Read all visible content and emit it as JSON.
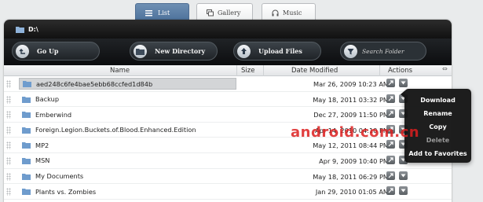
{
  "tabs": [
    {
      "label": "List",
      "icon": "list-icon",
      "active": true
    },
    {
      "label": "Gallery",
      "icon": "gallery-icon",
      "active": false
    },
    {
      "label": "Music",
      "icon": "headphones-icon",
      "active": false
    }
  ],
  "path": {
    "label": "D:\\",
    "icon": "folder-icon"
  },
  "toolbar": {
    "go_up": "Go Up",
    "new_directory": "New Directory",
    "upload_files": "Upload Files",
    "search_placeholder": "Search Folder"
  },
  "columns": {
    "name": "Name",
    "size": "Size",
    "date": "Date Modified",
    "actions": "Actions"
  },
  "rows": [
    {
      "name": "aed248c6fe4bae5ebb68ccfed1d84b",
      "size": "",
      "date": "Mar 26, 2009 10:23 AM",
      "selected": true
    },
    {
      "name": "Backup",
      "size": "",
      "date": "May 18, 2011 03:32 PM"
    },
    {
      "name": "Emberwind",
      "size": "",
      "date": "Dec 27, 2009 11:50 PM"
    },
    {
      "name": "Foreign.Legion.Buckets.of.Blood.Enhanced.Edition",
      "size": "",
      "date": "Apr 14, 2010 04:10 PM"
    },
    {
      "name": "MP2",
      "size": "",
      "date": "May 12, 2011 08:44 PM"
    },
    {
      "name": "MSN",
      "size": "",
      "date": "Apr 9, 2009 10:40 PM"
    },
    {
      "name": "My Documents",
      "size": "",
      "date": "May 18, 2011 06:29 PM"
    },
    {
      "name": "Plants vs. Zombies",
      "size": "",
      "date": "Jan 29, 2010 01:05 AM"
    }
  ],
  "context_menu": [
    "Download",
    "Rename",
    "Copy",
    "Delete",
    "Add to Favorites"
  ],
  "watermark": "android.com.cn",
  "colors": {
    "accent_tab": "#4a6f99",
    "toolbar": "#15171a",
    "folder": "#6f9ccd",
    "selected_row": "#d3d5d7"
  }
}
